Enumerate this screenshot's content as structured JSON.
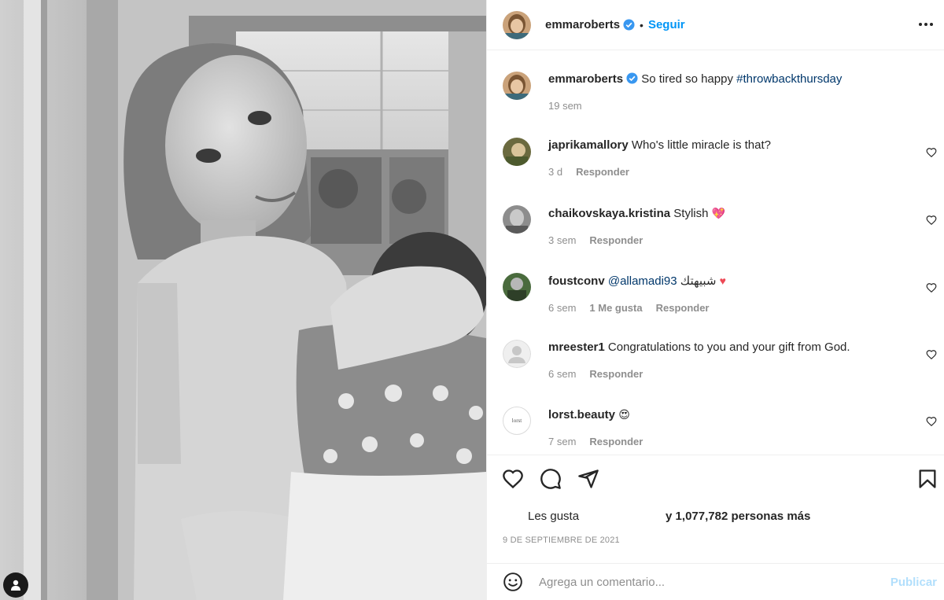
{
  "post": {
    "author": "emmaroberts",
    "follow_label": "Seguir",
    "dot": "•",
    "caption_text": "So tired so happy",
    "caption_hashtag": "#throwbackthursday",
    "caption_time": "19 sem",
    "likes_prefix": "Les gusta",
    "likes_suffix": "y 1,077,782 personas más",
    "date": "9 DE SEPTIEMBRE DE 2021"
  },
  "comments": [
    {
      "user": "japrikamallory",
      "text": "Who's little miracle is that?",
      "time": "3 d",
      "likes": "",
      "reply": "Responder"
    },
    {
      "user": "chaikovskaya.kristina",
      "text": "Stylish",
      "emoji": "💖",
      "time": "3 sem",
      "likes": "",
      "reply": "Responder"
    },
    {
      "user": "foustconv",
      "mention": "@allamadi93",
      "text": "شبيهتك",
      "emoji": "♥",
      "time": "6 sem",
      "likes": "1 Me gusta",
      "reply": "Responder"
    },
    {
      "user": "mreester1",
      "text": "Congratulations to you and your gift from God.",
      "time": "6 sem",
      "likes": "",
      "reply": "Responder"
    },
    {
      "user": "lorst.beauty",
      "text": "",
      "emoji": "😍",
      "time": "7 sem",
      "likes": "",
      "reply": "Responder",
      "avatar_text": "lorst"
    }
  ],
  "add_comment": {
    "placeholder": "Agrega un comentario...",
    "publish_label": "Publicar"
  },
  "icons": {
    "verified": "verified-badge-icon",
    "more": "more-options-icon",
    "like": "heart-icon",
    "comment": "comment-icon",
    "share": "paper-plane-icon",
    "save": "bookmark-icon",
    "emoji": "smiley-icon",
    "user_tag": "user-tag-icon"
  },
  "colors": {
    "accent": "#0095f6",
    "verified": "#3897f0",
    "link": "#00376b",
    "muted": "#8e8e8e",
    "publish_disabled": "#b2dffc"
  }
}
